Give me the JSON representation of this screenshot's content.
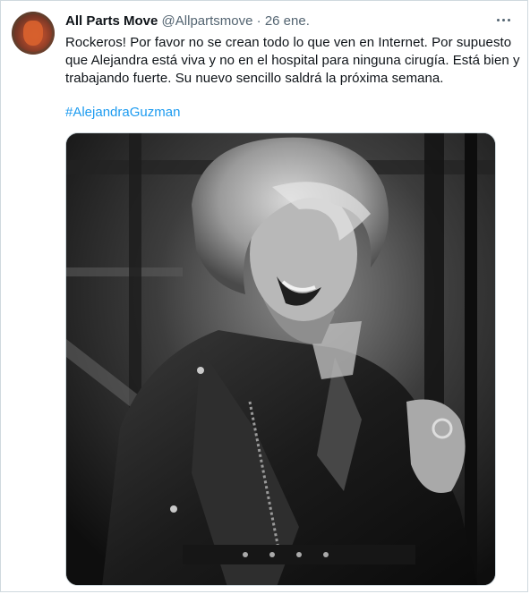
{
  "tweet": {
    "author_name": "All Parts Move",
    "handle": "@Allpartsmove",
    "separator": "·",
    "date": "26 ene.",
    "text_lines": [
      "Rockeros! Por favor no se crean todo lo que ven en Internet. Por supuesto",
      "que Alejandra está viva y no en el hospital para ninguna cirugía. Está bien y",
      "trabajando fuerte. Su nuevo sencillo saldrá la próxima semana."
    ],
    "hashtag": "#AlejandraGuzman"
  },
  "icons": {
    "more": "more-horizontal-icon",
    "avatar": "avatar-image"
  },
  "colors": {
    "link": "#1d9bf0",
    "text": "#0f1419",
    "secondary": "#536471",
    "border": "#cfd9de"
  }
}
